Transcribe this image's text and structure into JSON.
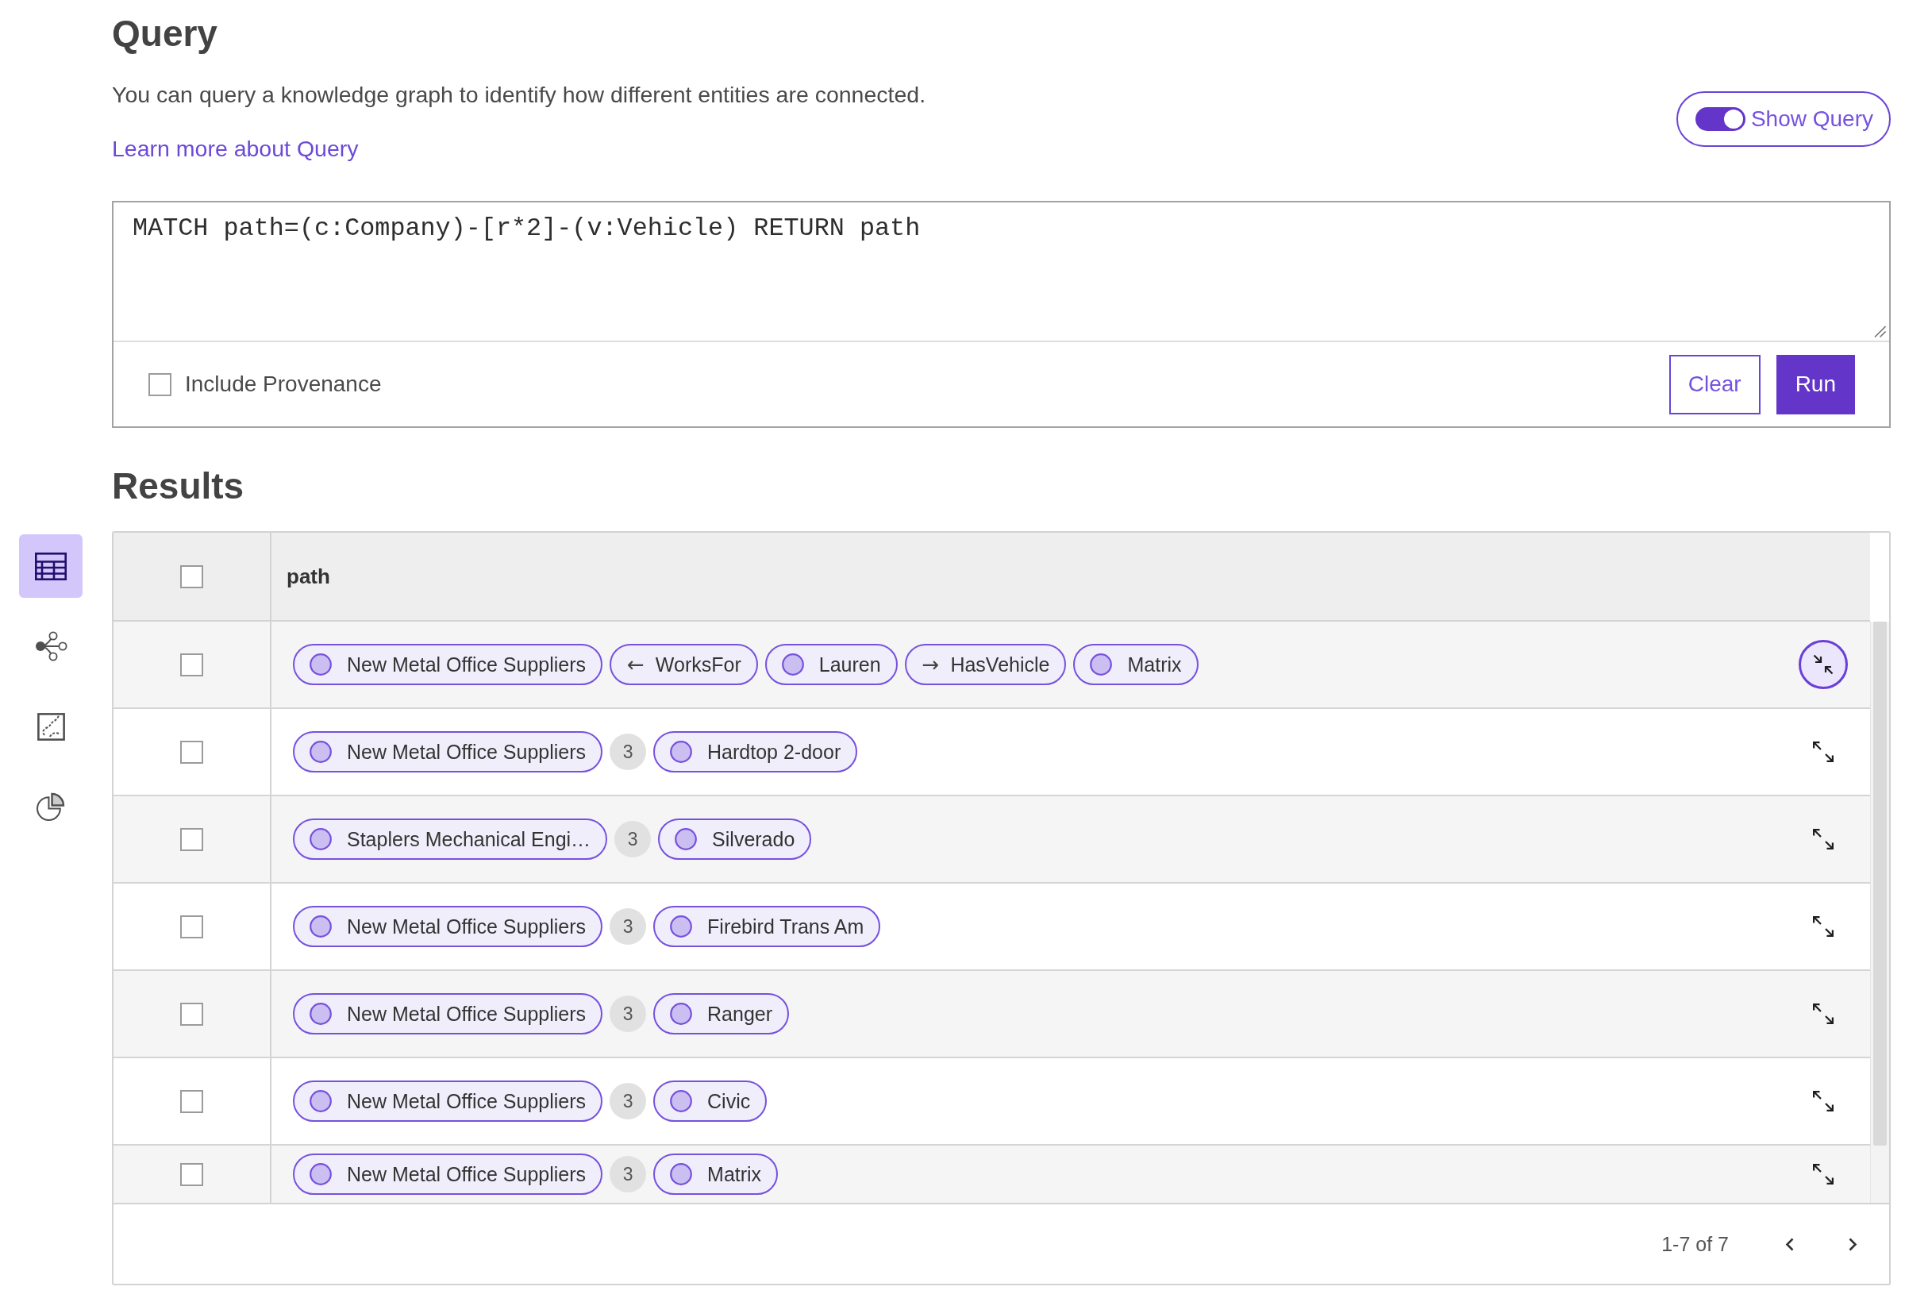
{
  "query": {
    "title": "Query",
    "description": "You can query a knowledge graph to identify how different entities are connected.",
    "link": "Learn more about Query",
    "toggle": {
      "label": "Show Query",
      "on": true
    },
    "editor": {
      "value": "MATCH path=(c:Company)-[r*2]-(v:Vehicle) RETURN path"
    },
    "provenance": {
      "label": "Include Provenance",
      "checked": false
    },
    "buttons": [
      {
        "label": "Clear",
        "kind": "secondary"
      },
      {
        "label": "Run",
        "kind": "primary"
      }
    ]
  },
  "sidebar": {
    "views": [
      {
        "kind": "table",
        "selected": true
      },
      {
        "kind": "graph",
        "selected": false
      },
      {
        "kind": "map",
        "selected": false
      },
      {
        "kind": "chart",
        "selected": false
      }
    ]
  },
  "results": {
    "title": "Results",
    "select_all": {
      "checked": false
    },
    "columns": [
      "path"
    ],
    "rows": [
      {
        "checked": false,
        "expanded": true,
        "segments": [
          {
            "kind": "node",
            "label": "New Metal Office Suppliers"
          },
          {
            "kind": "edge",
            "arrow": "←",
            "label": "WorksFor"
          },
          {
            "kind": "node",
            "label": "Lauren"
          },
          {
            "kind": "edge",
            "arrow": "→",
            "label": "HasVehicle"
          },
          {
            "kind": "node",
            "label": "Matrix"
          }
        ]
      },
      {
        "checked": false,
        "expanded": false,
        "segments": [
          {
            "kind": "node",
            "label": "New Metal Office Suppliers"
          },
          {
            "kind": "count",
            "label": "3"
          },
          {
            "kind": "node",
            "label": "Hardtop 2-door"
          }
        ]
      },
      {
        "checked": false,
        "expanded": false,
        "segments": [
          {
            "kind": "node",
            "label": "Staplers Mechanical Engi…"
          },
          {
            "kind": "count",
            "label": "3"
          },
          {
            "kind": "node",
            "label": "Silverado"
          }
        ]
      },
      {
        "checked": false,
        "expanded": false,
        "segments": [
          {
            "kind": "node",
            "label": "New Metal Office Suppliers"
          },
          {
            "kind": "count",
            "label": "3"
          },
          {
            "kind": "node",
            "label": "Firebird Trans Am"
          }
        ]
      },
      {
        "checked": false,
        "expanded": false,
        "segments": [
          {
            "kind": "node",
            "label": "New Metal Office Suppliers"
          },
          {
            "kind": "count",
            "label": "3"
          },
          {
            "kind": "node",
            "label": "Ranger"
          }
        ]
      },
      {
        "checked": false,
        "expanded": false,
        "segments": [
          {
            "kind": "node",
            "label": "New Metal Office Suppliers"
          },
          {
            "kind": "count",
            "label": "3"
          },
          {
            "kind": "node",
            "label": "Civic"
          }
        ]
      },
      {
        "checked": false,
        "expanded": false,
        "segments": [
          {
            "kind": "node",
            "label": "New Metal Office Suppliers"
          },
          {
            "kind": "count",
            "label": "3"
          },
          {
            "kind": "node",
            "label": "Matrix"
          }
        ]
      }
    ],
    "pagination": {
      "range": "1-7 of 7"
    }
  }
}
